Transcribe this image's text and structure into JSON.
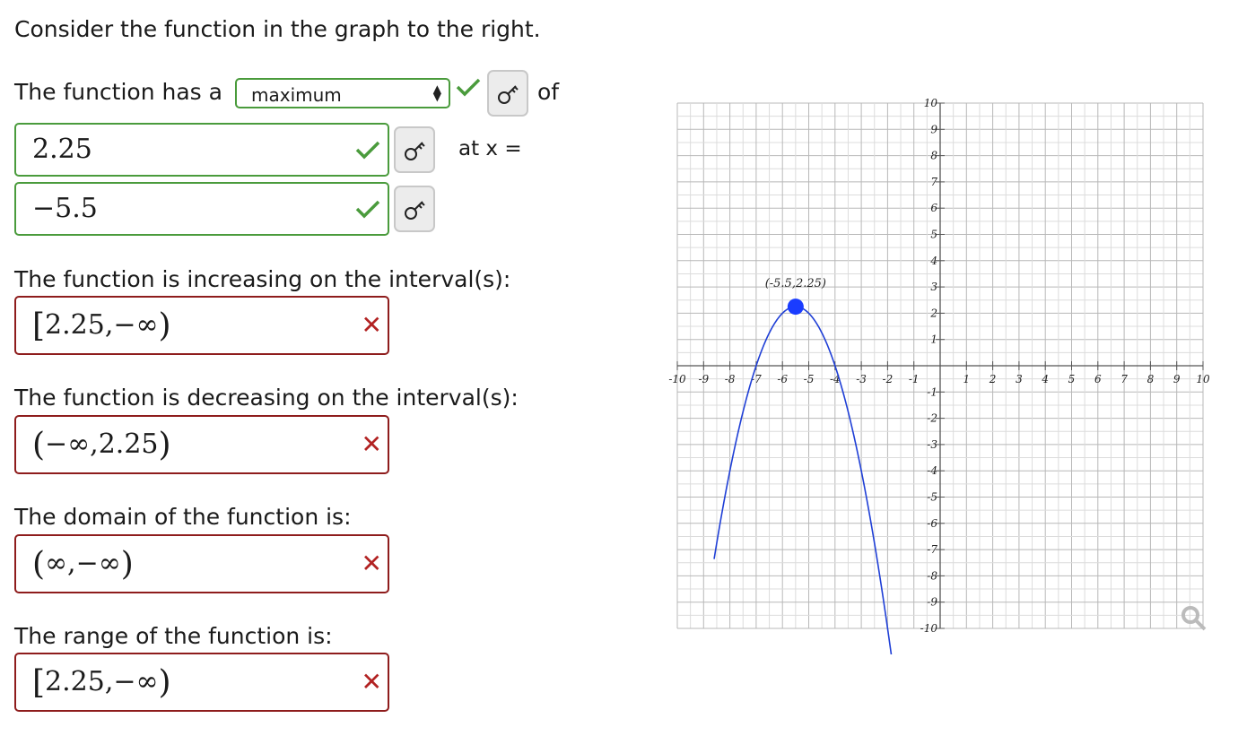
{
  "prompt": "Consider the function in the graph to the right.",
  "line1": {
    "prefix": "The function has a",
    "select_value": "maximum",
    "suffix": "of"
  },
  "value_answer": "2.25",
  "at_x_label": "at x =",
  "x_answer": "−5.5",
  "increasing": {
    "label": "The function is increasing on the interval(s):",
    "open": "[",
    "content": "2.25,−∞",
    "close": ")"
  },
  "decreasing": {
    "label": "The function is decreasing on the interval(s):",
    "open": "(",
    "content": "−∞,2.25",
    "close": ")"
  },
  "domain": {
    "label": "The domain of the function is:",
    "open": "(",
    "content": "∞,−∞",
    "close": ")"
  },
  "range": {
    "label": "The range of the function is:",
    "open": "[",
    "content": "2.25,−∞",
    "close": ")"
  },
  "icons": {
    "correct": "check-icon",
    "incorrect": "cross-icon",
    "key": "key-icon",
    "zoom": "magnifier-icon"
  },
  "colors": {
    "correct": "#4a9b3c",
    "incorrect": "#b22222",
    "curve": "#1f3fd6",
    "vertex": "#1a3cff",
    "grid": "#bdbdbd"
  },
  "chart_data": {
    "type": "line",
    "x_range": [
      -10,
      10
    ],
    "y_range": [
      -10,
      10
    ],
    "grid": true,
    "x_ticks": [
      "-10",
      "-9",
      "-8",
      "-7",
      "-6",
      "-5",
      "-4",
      "-3",
      "-2",
      "-1",
      "1",
      "2",
      "3",
      "4",
      "5",
      "6",
      "7",
      "8",
      "9",
      "10"
    ],
    "y_ticks": [
      "10",
      "9",
      "8",
      "7",
      "6",
      "5",
      "4",
      "3",
      "2",
      "1",
      "-1",
      "-2",
      "-3",
      "-4",
      "-5",
      "-6",
      "-7",
      "-8",
      "-9",
      "-10"
    ],
    "vertex": {
      "x": -5.5,
      "y": 2.25,
      "label": "(-5.5,2.25)"
    },
    "curve": {
      "points": [
        [
          -8.6,
          -10
        ],
        [
          -7,
          0
        ],
        [
          -5.5,
          2.25
        ],
        [
          -4,
          0
        ],
        [
          -1.6,
          -10
        ]
      ]
    }
  }
}
